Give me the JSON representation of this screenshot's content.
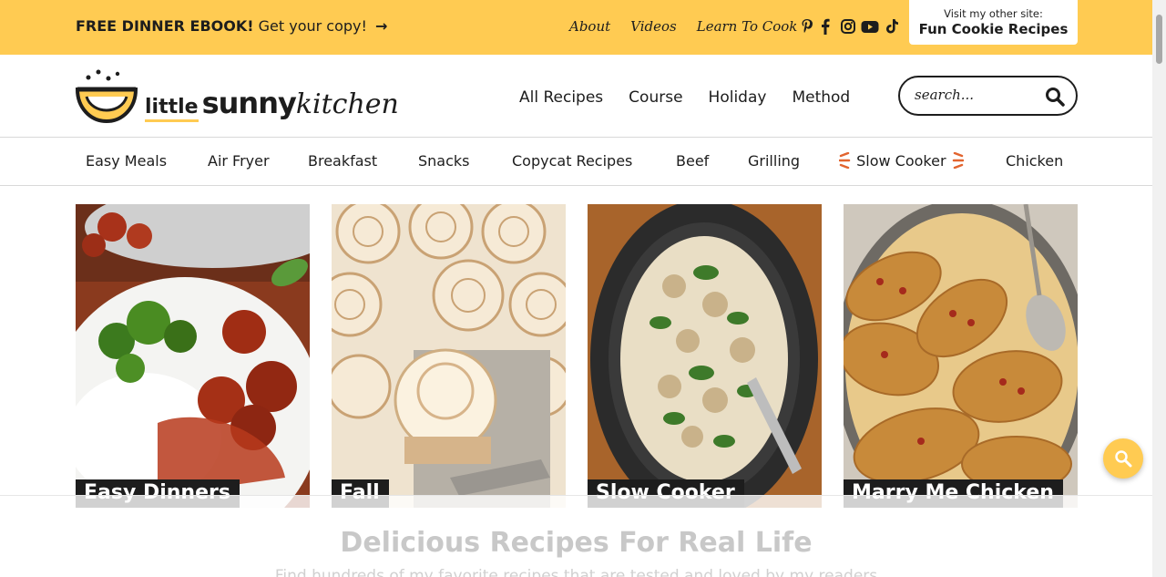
{
  "topbar": {
    "promo_bold": "FREE DINNER EBOOK!",
    "promo_text": "Get your copy!",
    "promo_arrow": "→",
    "links": [
      "About",
      "Videos",
      "Learn To Cook"
    ],
    "social_icons": [
      "pinterest-icon",
      "facebook-icon",
      "instagram-icon",
      "youtube-icon",
      "tiktok-icon"
    ],
    "other_site_small": "Visit my other site:",
    "other_site_big": "Fun Cookie Recipes"
  },
  "logo": {
    "little": "little",
    "sunny": "sunny",
    "kitchen": "kitchen"
  },
  "mainnav": [
    "All Recipes",
    "Course",
    "Holiday",
    "Method"
  ],
  "search": {
    "placeholder": "search..."
  },
  "subnav": [
    "Easy Meals",
    "Air Fryer",
    "Breakfast",
    "Snacks",
    "Copycat Recipes",
    "Beef",
    "Grilling",
    "Slow Cooker",
    "Chicken"
  ],
  "cards": [
    "Easy Dinners",
    "Fall",
    "Slow Cooker",
    "Marry Me Chicken"
  ],
  "tagline": "Delicious Recipes For Real Life",
  "subtagline": "Find hundreds of my favorite recipes that are tested and loved by my readers",
  "colors": {
    "accent": "#ffcb52",
    "dark": "#1d1d1d",
    "orange": "#e2642f"
  }
}
